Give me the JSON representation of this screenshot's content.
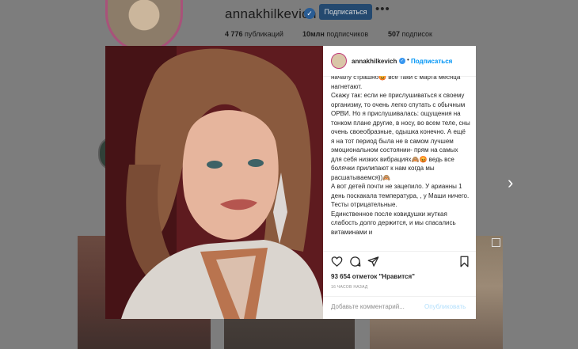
{
  "profile": {
    "username": "annakhilkevich",
    "follow_label": "Подписаться",
    "more_icon": "more-horizontal-icon",
    "stats": {
      "posts_value": "4 776",
      "posts_label": "публикаций",
      "followers_value": "10млн",
      "followers_label": "подписчиков",
      "following_value": "507",
      "following_label": "подписок"
    }
  },
  "modal": {
    "username": "annakhilkevich",
    "separator": "•",
    "follow_label": "Подписаться",
    "caption": {
      "lines": [
        "началу страшно😡 все таки с марта месяца нагнетают.",
        "Скажу так: если не прислушиваться к своему организму, то очень легко спутать с обычным ОРВИ. Но я прислушивалась: ощущения на тонком плане другие, в носу, во всем теле, сны очень своеобразные, одышка конечно. А ещё я на тот период была не в самом лучшем эмоциональном состоянии- прям на самых для себя низких вибрациях🙈😡 ведь все болячки прилипают к нам когда мы расшатываемся))🙈",
        "А вот детей почти не зацепило. У арианны 1 день поскакала температура, , у Маши ничего. Тесты отрицательные.",
        "Единственное после ковидушки жуткая слабость долго держится, и мы спасались витаминами и"
      ]
    },
    "likes_count": "93 654",
    "likes_text": "отметок \"Нравится\"",
    "timestamp": "16 ЧАСОВ НАЗАД",
    "comment_placeholder": "Добавьте комментарий...",
    "publish_label": "Опубликовать"
  },
  "icons": [
    "heart-icon",
    "comment-icon",
    "share-icon",
    "bookmark-icon",
    "chevron-right-icon",
    "verified-icon",
    "carousel-icon"
  ],
  "colors": {
    "overlay": "#7d7d7d",
    "follow_button": "#24496f",
    "link_blue": "#0095f6",
    "publish_disabled": "#b2dffc",
    "verified": "#3897f0"
  }
}
